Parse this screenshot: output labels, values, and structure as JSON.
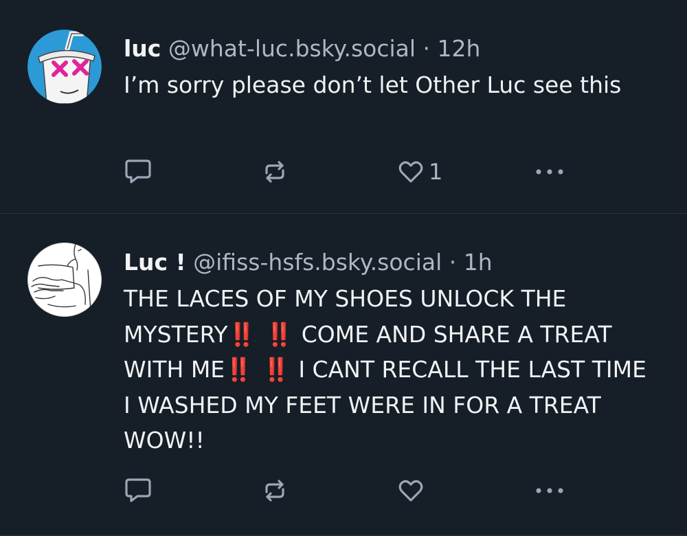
{
  "posts": [
    {
      "display_name": "luc",
      "handle": "@what-luc.bsky.social",
      "separator": "·",
      "time": "12h",
      "text": "I’m sorry please don’t let Other Luc see this",
      "like_count": "1",
      "avatar": "drink-cup-with-x-eyes-avatar"
    },
    {
      "display_name": "Luc !",
      "handle": "@ifiss-hsfs.bsky.social",
      "separator": "·",
      "time": "1h",
      "text_parts": {
        "p1": "THE LACES OF MY SHOES UNLOCK THE MYSTERY",
        "bang1": "‼️ ‼️",
        "p2": " COME AND SHARE A TREAT WITH ME",
        "bang2": "‼️ ‼️",
        "p3": " I CANT RECALL THE LAST TIME I WASHED MY FEET WERE IN FOR A TREAT WOW!!"
      },
      "like_count": "",
      "avatar": "line-drawing-figure-avatar"
    }
  ],
  "icons": {
    "reply": "speech-bubble-icon",
    "repost": "repost-arrows-icon",
    "like": "heart-icon",
    "more": "ellipsis-icon"
  },
  "colors": {
    "background": "#161e27",
    "text": "#f1f3f5",
    "muted": "#aeb8c4",
    "icon": "#9aa7b6",
    "divider": "#2b3643",
    "accent_pink": "#e0249c",
    "accent_red": "#e0241f"
  }
}
